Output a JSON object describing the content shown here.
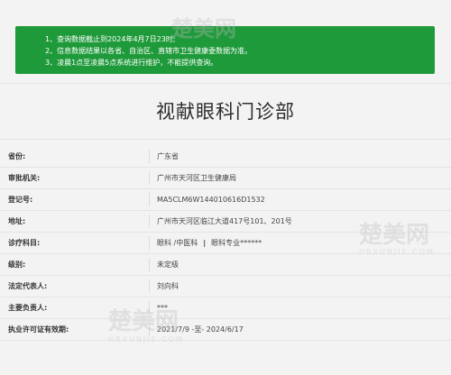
{
  "notice": {
    "lines": [
      "1、查询数据截止到2024年4月7日23时;",
      "2、信息数据结果以各省、自治区、直辖市卫生健康委数据为准。",
      "3、凌晨1点至凌晨5点系统进行维护，不能提供查询。"
    ]
  },
  "page_title": "视献眼科门诊部",
  "rows": [
    {
      "label": "省份:",
      "value": "广东省"
    },
    {
      "label": "审批机关:",
      "value": "广州市天河区卫生健康局"
    },
    {
      "label": "登记号:",
      "value": "MA5CLM6W144010616D1532"
    },
    {
      "label": "地址:",
      "value": "广州市天河区临江大道417号101、201号"
    },
    {
      "label": "诊疗科目:",
      "value_a": "眼科 /中医科",
      "pipe": "|",
      "value_b": "眼科专业******"
    },
    {
      "label": "级别:",
      "value": "未定级"
    },
    {
      "label": "法定代表人:",
      "value": "刘向科"
    },
    {
      "label": "主要负责人:",
      "value": "***"
    },
    {
      "label": "执业许可证有效期:",
      "value": "2021/7/9 -至- 2024/6/17"
    }
  ],
  "watermark": {
    "text": "楚美网",
    "sub": "HBXUNJIE.COM"
  },
  "colors": {
    "notice_bg": "#1f9a3a",
    "page_bg": "#f3f3f3"
  }
}
